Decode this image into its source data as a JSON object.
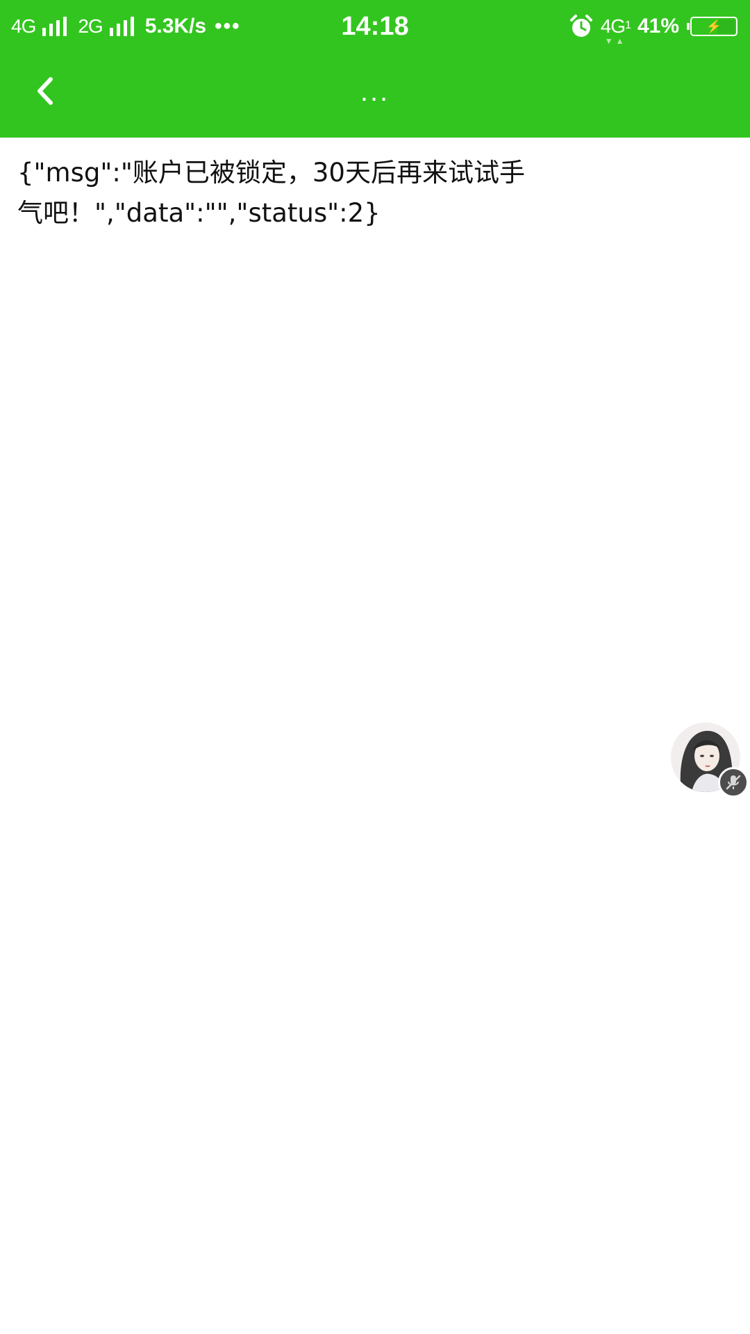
{
  "status_bar": {
    "network_primary": "4G",
    "network_secondary": "2G",
    "net_speed": "5.3K/s",
    "overflow_dots": "•••",
    "time": "14:18",
    "data_network": "4G",
    "data_network_sim": "1",
    "battery_percent": "41%",
    "battery_level": 0.41,
    "colors": {
      "background": "#33c51f",
      "bolt": "#f7e000"
    },
    "icons": [
      "signal-icon",
      "alarm-icon",
      "battery-charging-icon"
    ]
  },
  "app_bar": {
    "back_icon": "chevron-left-icon",
    "title": "...",
    "background": "#33c51f"
  },
  "main": {
    "response_text": "{\"msg\":\"账户已被锁定，30天后再来试试手气吧！\",\"data\":\"\",\"status\":2}"
  },
  "floating": {
    "avatar_icon": "avatar",
    "badge_icon": "mic-muted-icon"
  }
}
